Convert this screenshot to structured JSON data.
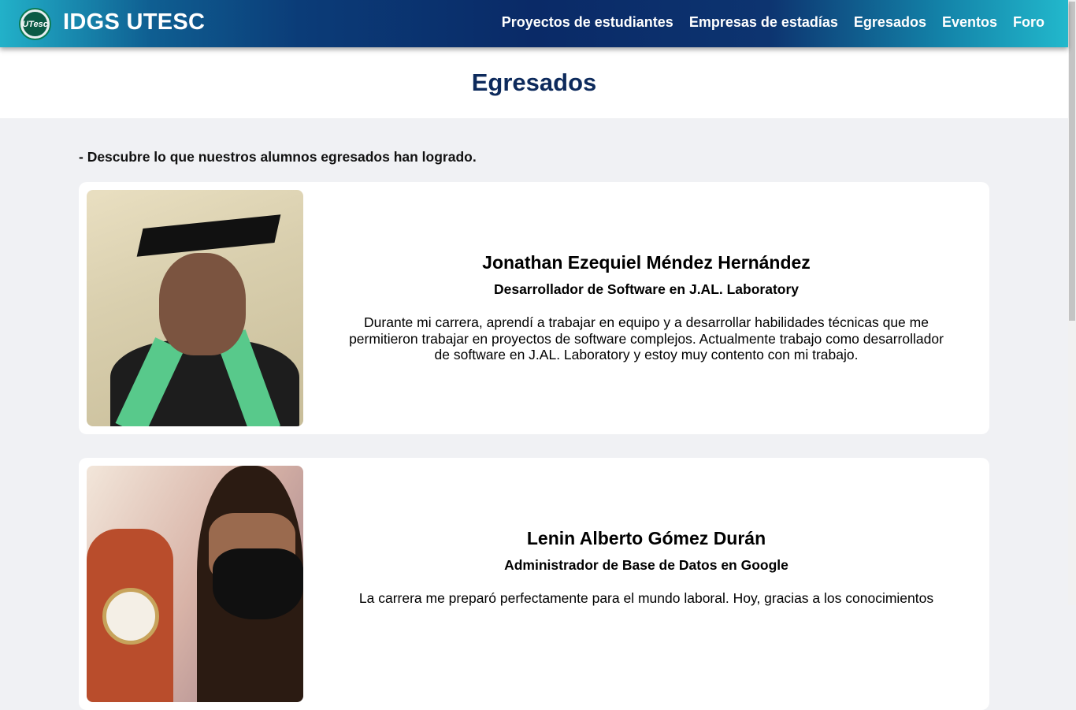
{
  "header": {
    "brand": "IDGS UTESC",
    "logo_text": "UTesc",
    "nav": [
      {
        "label": "Proyectos de estudiantes"
      },
      {
        "label": "Empresas de estadías"
      },
      {
        "label": "Egresados"
      },
      {
        "label": "Eventos"
      },
      {
        "label": "Foro"
      }
    ]
  },
  "page": {
    "title": "Egresados",
    "intro": "- Descubre lo que nuestros alumnos egresados han logrado."
  },
  "graduates": [
    {
      "name": "Jonathan Ezequiel Méndez Hernández",
      "role": "Desarrollador de Software en J.AL. Laboratory",
      "description": "Durante mi carrera, aprendí a trabajar en equipo y a desarrollar habilidades técnicas que me permitieron trabajar en proyectos de software complejos. Actualmente trabajo como desarrollador de software en J.AL. Laboratory y estoy muy contento con mi trabajo."
    },
    {
      "name": "Lenin Alberto Gómez Durán",
      "role": "Administrador de Base de Datos en Google",
      "description": "La carrera me preparó perfectamente para el mundo laboral. Hoy, gracias a los conocimientos"
    }
  ],
  "colors": {
    "title": "#0d2a5c",
    "background": "#f0f1f4",
    "header_dark": "#0a2a67",
    "header_light": "#22b1c9"
  }
}
